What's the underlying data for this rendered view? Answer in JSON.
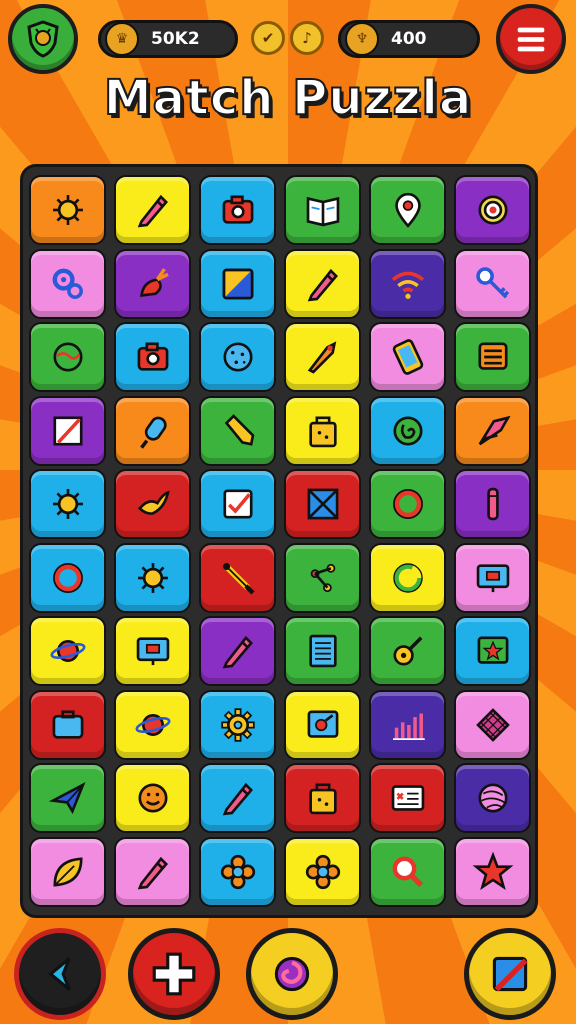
{
  "header": {
    "coins_value": "50K2",
    "gems_value": "400",
    "title": "Match Puzzla"
  },
  "colors": {
    "orange": "#f88a1c",
    "yellow": "#f9ec1a",
    "blue": "#1fb0ea",
    "green": "#3cb33c",
    "purple": "#8a2fc4",
    "pink": "#f28ce0",
    "red": "#d42222",
    "indigo": "#4a2ca6"
  },
  "board": {
    "rows": [
      [
        {
          "color": "orange",
          "icon": "sun-icon"
        },
        {
          "color": "yellow",
          "icon": "pencil-icon"
        },
        {
          "color": "blue",
          "icon": "camera-icon"
        },
        {
          "color": "green",
          "icon": "book-icon"
        },
        {
          "color": "green",
          "icon": "location-pin-icon"
        },
        {
          "color": "purple",
          "icon": "target-icon"
        }
      ],
      [
        {
          "color": "pink",
          "icon": "gears-icon"
        },
        {
          "color": "purple",
          "icon": "radish-icon"
        },
        {
          "color": "blue",
          "icon": "picture-icon"
        },
        {
          "color": "yellow",
          "icon": "pencil-icon"
        },
        {
          "color": "indigo",
          "icon": "wifi-icon"
        },
        {
          "color": "pink",
          "icon": "key-icon"
        }
      ],
      [
        {
          "color": "green",
          "icon": "globe-icon"
        },
        {
          "color": "blue",
          "icon": "camera-icon"
        },
        {
          "color": "blue",
          "icon": "cookie-icon"
        },
        {
          "color": "yellow",
          "icon": "rocket-icon"
        },
        {
          "color": "pink",
          "icon": "phone-icon"
        },
        {
          "color": "green",
          "icon": "list-icon"
        }
      ],
      [
        {
          "color": "purple",
          "icon": "note-icon"
        },
        {
          "color": "orange",
          "icon": "popsicle-icon"
        },
        {
          "color": "green",
          "icon": "crayon-icon"
        },
        {
          "color": "yellow",
          "icon": "bag-icon"
        },
        {
          "color": "blue",
          "icon": "spiral-icon"
        },
        {
          "color": "orange",
          "icon": "compass-icon"
        }
      ],
      [
        {
          "color": "blue",
          "icon": "sun-icon"
        },
        {
          "color": "red",
          "icon": "bird-icon"
        },
        {
          "color": "blue",
          "icon": "checkbox-icon"
        },
        {
          "color": "red",
          "icon": "envelope-icon"
        },
        {
          "color": "green",
          "icon": "ring-icon"
        },
        {
          "color": "purple",
          "icon": "tube-icon"
        }
      ],
      [
        {
          "color": "blue",
          "icon": "ring-icon"
        },
        {
          "color": "blue",
          "icon": "sun-icon"
        },
        {
          "color": "red",
          "icon": "brush-icon"
        },
        {
          "color": "green",
          "icon": "share-icon"
        },
        {
          "color": "yellow",
          "icon": "refresh-icon"
        },
        {
          "color": "pink",
          "icon": "monitor-icon"
        }
      ],
      [
        {
          "color": "yellow",
          "icon": "planet-icon"
        },
        {
          "color": "yellow",
          "icon": "monitor-icon"
        },
        {
          "color": "purple",
          "icon": "pencil-icon"
        },
        {
          "color": "green",
          "icon": "notebook-icon"
        },
        {
          "color": "green",
          "icon": "guitar-icon"
        },
        {
          "color": "blue",
          "icon": "star-frame-icon"
        }
      ],
      [
        {
          "color": "red",
          "icon": "briefcase-icon"
        },
        {
          "color": "yellow",
          "icon": "planet-icon"
        },
        {
          "color": "blue",
          "icon": "gear-icon"
        },
        {
          "color": "yellow",
          "icon": "record-icon"
        },
        {
          "color": "indigo",
          "icon": "bar-chart-icon"
        },
        {
          "color": "pink",
          "icon": "waffle-icon"
        }
      ],
      [
        {
          "color": "green",
          "icon": "paper-plane-icon"
        },
        {
          "color": "yellow",
          "icon": "smiley-icon"
        },
        {
          "color": "blue",
          "icon": "pencil-icon"
        },
        {
          "color": "red",
          "icon": "bag-icon"
        },
        {
          "color": "red",
          "icon": "card-icon"
        },
        {
          "color": "indigo",
          "icon": "yarn-icon"
        }
      ],
      [
        {
          "color": "pink",
          "icon": "leaf-icon"
        },
        {
          "color": "pink",
          "icon": "pencil-icon"
        },
        {
          "color": "blue",
          "icon": "flower-icon"
        },
        {
          "color": "yellow",
          "icon": "flower-icon"
        },
        {
          "color": "green",
          "icon": "magnifier-icon"
        },
        {
          "color": "pink",
          "icon": "star-icon"
        }
      ]
    ]
  },
  "controls": {
    "back_icon": "back-arrow-icon",
    "add_icon": "plus-icon",
    "special_icon": "swirl-icon",
    "edit_icon": "edit-icon"
  }
}
